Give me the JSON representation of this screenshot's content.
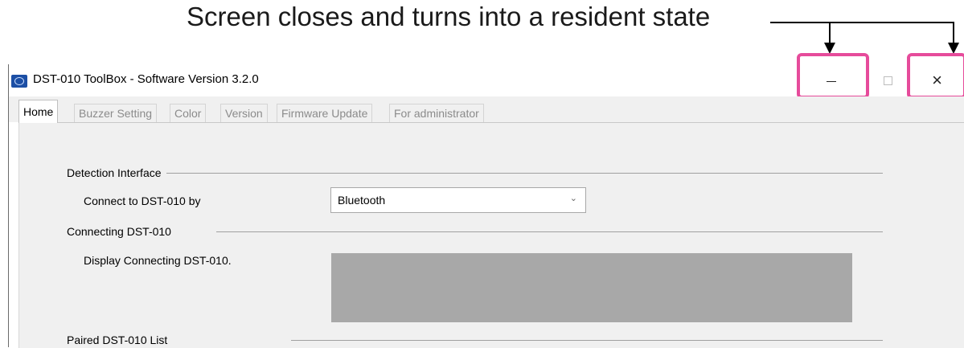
{
  "annotation": {
    "text": "Screen closes and turns into a resident state",
    "highlight_color": "#e64b9b"
  },
  "window": {
    "title_prefix": "DST-010 ToolBox - Software Version 3.2.0",
    "app_icon": "dst-app-icon",
    "controls": {
      "minimize": "minimize-icon",
      "maximize": "maximize-icon",
      "close_glyph": "×"
    }
  },
  "tabs": [
    {
      "label": "Home",
      "active": true
    },
    {
      "label": "Buzzer Setting",
      "active": false
    },
    {
      "label": "Color",
      "active": false
    },
    {
      "label": "Version",
      "active": false
    },
    {
      "label": "Firmware Update",
      "active": false
    },
    {
      "label": "For administrator",
      "active": false
    }
  ],
  "home": {
    "detection_interface": {
      "group_label": "Detection Interface",
      "connect_label": "Connect to DST-010 by",
      "connect_value": "Bluetooth"
    },
    "connecting": {
      "group_label": "Connecting DST-010",
      "display_label": "Display Connecting DST-010."
    },
    "paired": {
      "group_label": "Paired DST-010 List"
    }
  }
}
